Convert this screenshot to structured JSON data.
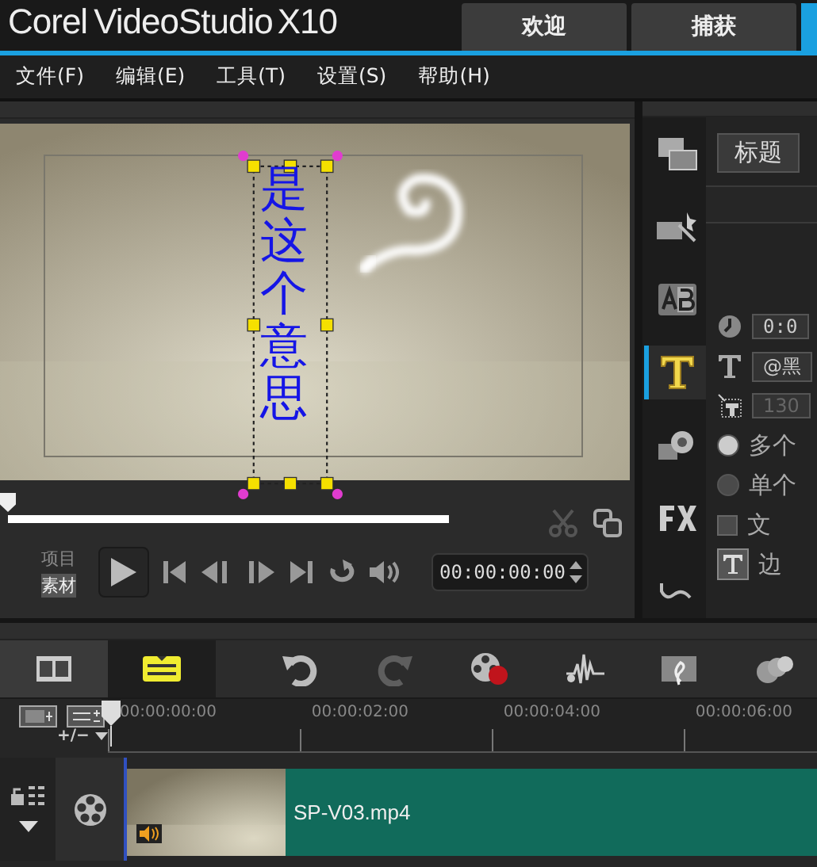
{
  "header": {
    "logo": {
      "brand": "Corel",
      "product": "VideoStudio",
      "version": "X10"
    },
    "tabs": [
      {
        "label": "欢迎",
        "selected": false
      },
      {
        "label": "捕获",
        "selected": false
      }
    ]
  },
  "menu": [
    "文件(F)",
    "编辑(E)",
    "工具(T)",
    "设置(S)",
    "帮助(H)"
  ],
  "preview": {
    "title_text": "是这个意思",
    "scrubber": {
      "level": 0
    },
    "modes": [
      {
        "label": "项目",
        "selected": false
      },
      {
        "label": "素材",
        "selected": true
      }
    ],
    "timecode": "00:00:00:00"
  },
  "options_panel": {
    "tab": "标题",
    "categories": [
      {
        "kind": "media",
        "selected": false
      },
      {
        "kind": "instant",
        "selected": false
      },
      {
        "kind": "transition",
        "selected": false
      },
      {
        "kind": "title",
        "selected": true
      },
      {
        "kind": "graphic",
        "selected": false
      },
      {
        "kind": "filter",
        "selected": false
      },
      {
        "kind": "path",
        "selected": false
      }
    ],
    "fields": [
      {
        "kind": "duration",
        "value": "0:0",
        "disabled": false
      },
      {
        "kind": "font",
        "value": "@黑",
        "disabled": false
      },
      {
        "kind": "size",
        "value": "130",
        "disabled": true
      }
    ],
    "options": [
      {
        "kind": "radio",
        "label": "多个",
        "selected": true
      },
      {
        "kind": "radio",
        "label": "单个",
        "selected": false
      },
      {
        "kind": "checkbox",
        "label": "文",
        "checked": false
      },
      {
        "kind": "button",
        "label": "边"
      }
    ]
  },
  "timeline": {
    "views": [
      {
        "kind": "storyboard",
        "selected": false
      },
      {
        "kind": "timeline",
        "selected": true
      }
    ],
    "tools": [
      {
        "kind": "undo",
        "disabled": false
      },
      {
        "kind": "redo",
        "disabled": true
      },
      {
        "kind": "record",
        "disabled": false
      },
      {
        "kind": "mixer",
        "disabled": false
      },
      {
        "kind": "music",
        "disabled": false
      },
      {
        "kind": "more",
        "disabled": false
      }
    ],
    "track_menu": "+/−",
    "ruler": [
      "00:00:00:00",
      "00:00:02:00",
      "00:00:04:00",
      "00:00:06:00"
    ],
    "clips": [
      {
        "name": "SP-V03.mp4"
      }
    ]
  }
}
